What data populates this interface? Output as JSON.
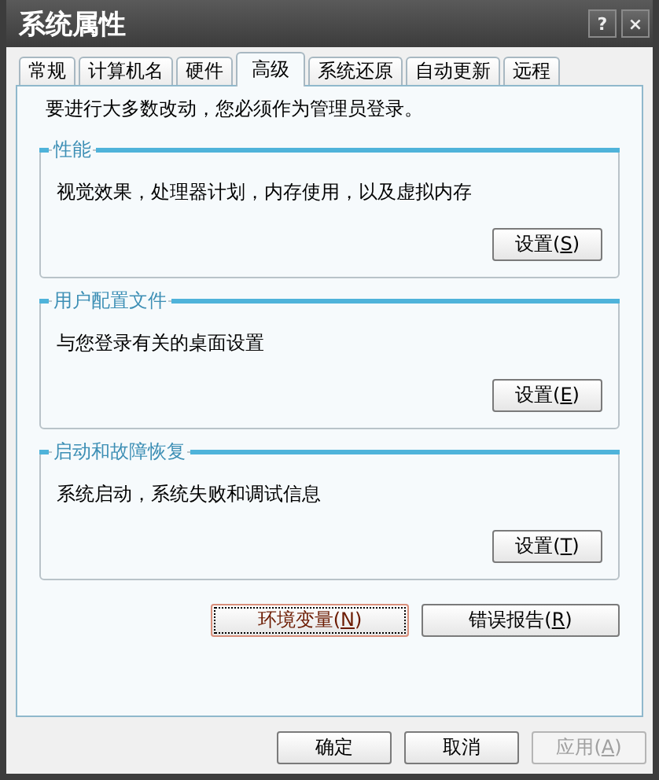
{
  "window": {
    "title": "系统属性",
    "help_button": "?",
    "close_button": "×"
  },
  "tabs": [
    {
      "label": "常规",
      "selected": false
    },
    {
      "label": "计算机名",
      "selected": false
    },
    {
      "label": "硬件",
      "selected": false
    },
    {
      "label": "高级",
      "selected": true
    },
    {
      "label": "系统还原",
      "selected": false
    },
    {
      "label": "自动更新",
      "selected": false
    },
    {
      "label": "远程",
      "selected": false
    }
  ],
  "notice": "要进行大多数改动，您必须作为管理员登录。",
  "groups": [
    {
      "title": "性能",
      "description": "视觉效果，处理器计划，内存使用，以及虚拟内存",
      "button": "设置(S)"
    },
    {
      "title": "用户配置文件",
      "description": "与您登录有关的桌面设置",
      "button": "设置(E)"
    },
    {
      "title": "启动和故障恢复",
      "description": "系统启动，系统失败和调试信息",
      "button": "设置(T)"
    }
  ],
  "extra_buttons": [
    {
      "label": "环境变量(N)",
      "focused": true
    },
    {
      "label": "错误报告(R)",
      "focused": false
    }
  ],
  "dialog_buttons": [
    {
      "label": "确定",
      "disabled": false
    },
    {
      "label": "取消",
      "disabled": false
    },
    {
      "label": "应用(A)",
      "disabled": true
    }
  ]
}
